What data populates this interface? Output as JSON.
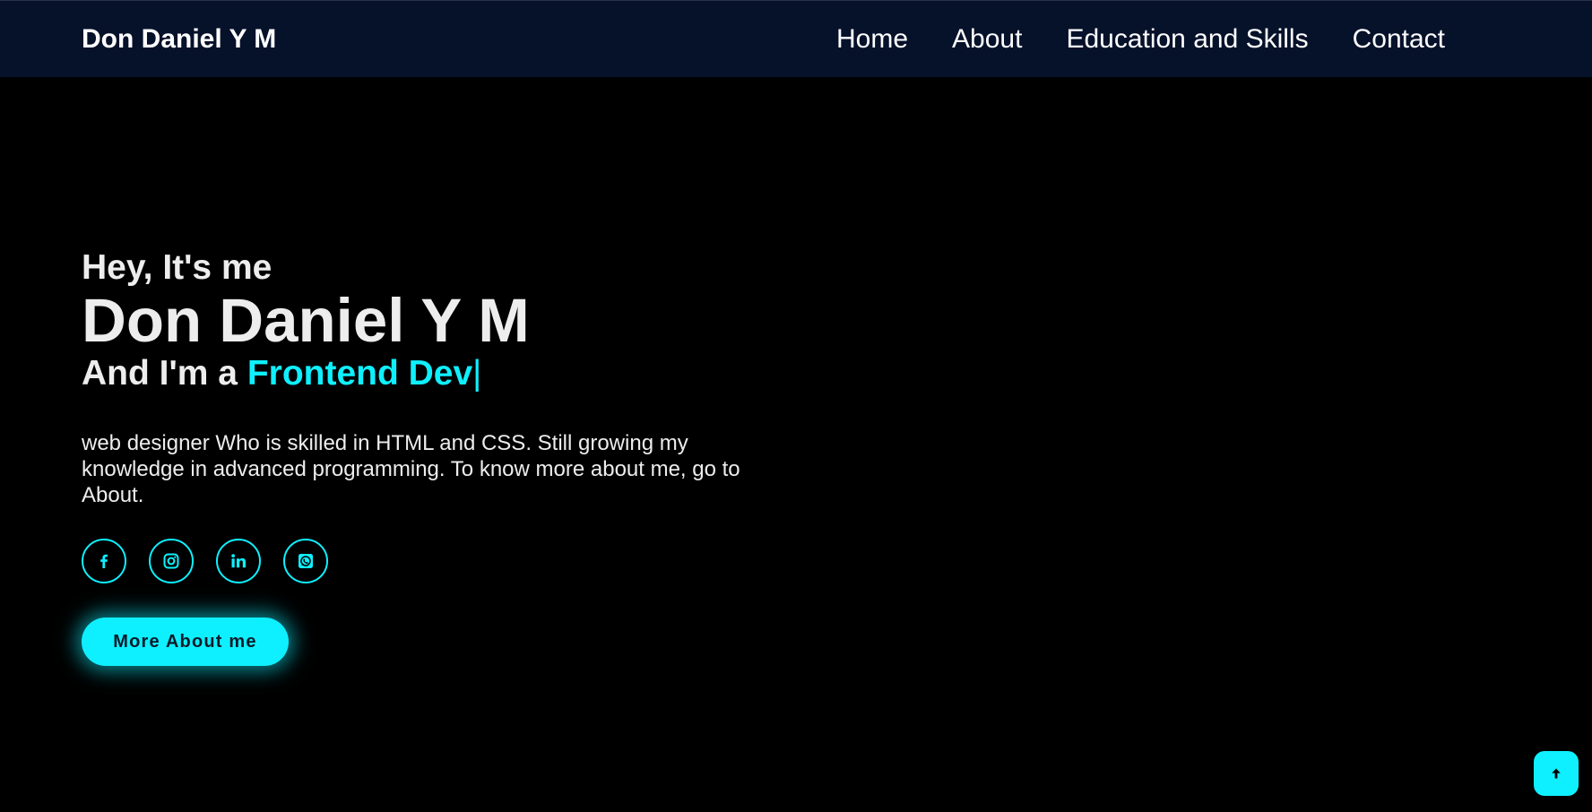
{
  "navbar": {
    "logo": "Don Daniel Y M",
    "links": [
      {
        "label": "Home"
      },
      {
        "label": "About"
      },
      {
        "label": "Education and Skills"
      },
      {
        "label": "Contact"
      }
    ],
    "background": "#06112a"
  },
  "hero": {
    "greeting": "Hey, It's me",
    "name": "Don Daniel Y M",
    "role_prefix": "And I'm a",
    "role_highlight": "Frontend Dev",
    "typing_cursor": "|",
    "bio": "web designer Who is skilled in HTML and CSS. Still growing my knowledge in advanced programming. To know more about me, go to About."
  },
  "socials": [
    {
      "icon": "facebook-icon"
    },
    {
      "icon": "instagram-icon"
    },
    {
      "icon": "linkedin-icon"
    },
    {
      "icon": "whatsapp-icon"
    }
  ],
  "cta": {
    "label": "More About me"
  },
  "back_to_top": {
    "icon": "arrow-up-icon"
  },
  "colors": {
    "accent": "#0ef0ff",
    "background": "#000000",
    "text": "#ededed"
  }
}
